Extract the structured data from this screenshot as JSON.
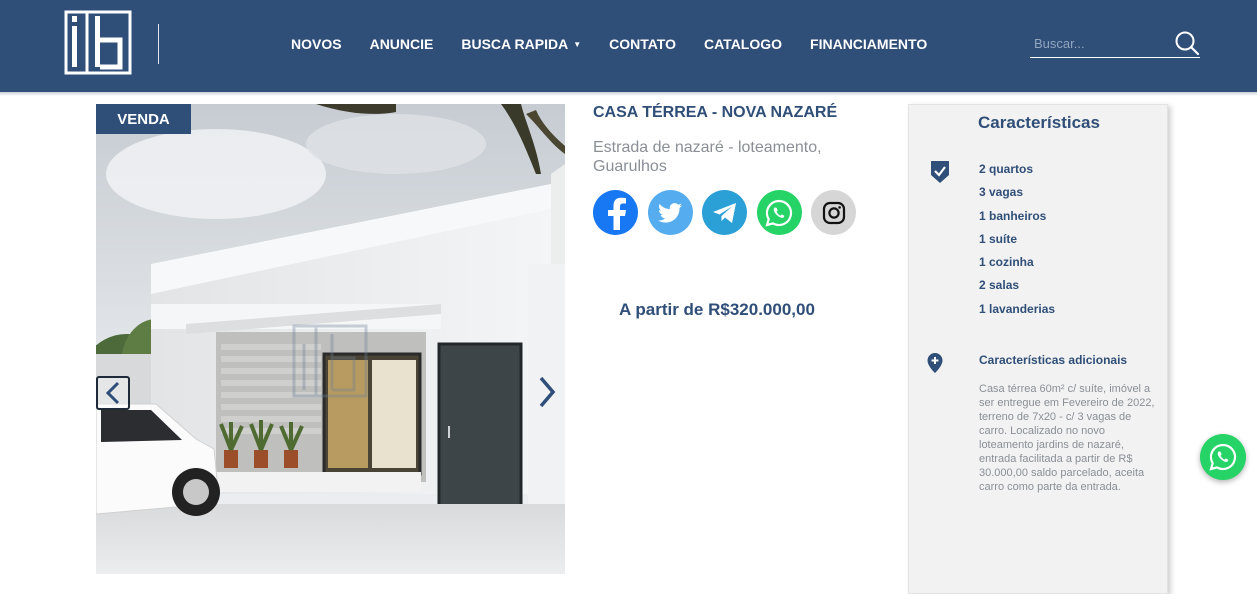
{
  "header": {
    "logo_text": "ib",
    "nav": [
      {
        "label": "NOVOS"
      },
      {
        "label": "ANUNCIE"
      },
      {
        "label": "BUSCA RAPIDA",
        "has_dropdown": true
      },
      {
        "label": "CONTATO"
      },
      {
        "label": "CATALOGO"
      },
      {
        "label": "FINANCIAMENTO"
      }
    ],
    "search": {
      "placeholder": "Buscar...",
      "value": "",
      "icon": "search-icon"
    }
  },
  "gallery": {
    "badge": "VENDA",
    "watermark": "ib",
    "prev_icon": "chevron-left-icon",
    "next_icon": "chevron-right-icon"
  },
  "property": {
    "title": "CASA TÉRREA - NOVA NAZARÉ",
    "address": "Estrada de nazaré - loteamento, Guarulhos",
    "price": "A partir de R$320.000,00"
  },
  "share": [
    {
      "name": "facebook",
      "icon": "facebook-icon",
      "color": "#1877f2"
    },
    {
      "name": "twitter",
      "icon": "twitter-icon",
      "color": "#55acee"
    },
    {
      "name": "telegram",
      "icon": "telegram-icon",
      "color": "#2ba0d6"
    },
    {
      "name": "whatsapp",
      "icon": "whatsapp-icon",
      "color": "#25d366"
    },
    {
      "name": "instagram",
      "icon": "instagram-icon",
      "color": "#d6d6d6"
    }
  ],
  "characteristics": {
    "title": "Características",
    "items": [
      "2 quartos",
      "3 vagas",
      "1 banheiros",
      "1 suíte",
      "1 cozinha",
      "2 salas",
      "1 lavanderias"
    ],
    "additional_title": "Características adicionais",
    "additional_text": "Casa térrea 60m² c/ suíte, imóvel a ser entregue em Fevereiro de 2022, terreno de 7x20 - c/ 3 vagas de carro. Localizado no novo loteamento jardins de nazaré, entrada facilitada a partir de R$ 30.000,00 saldo parcelado, aceita carro como parte da entrada."
  },
  "colors": {
    "brand": "#2f4e78",
    "muted_text": "#8a8f96",
    "panel_bg": "#f2f2f2",
    "whatsapp": "#25d366"
  }
}
